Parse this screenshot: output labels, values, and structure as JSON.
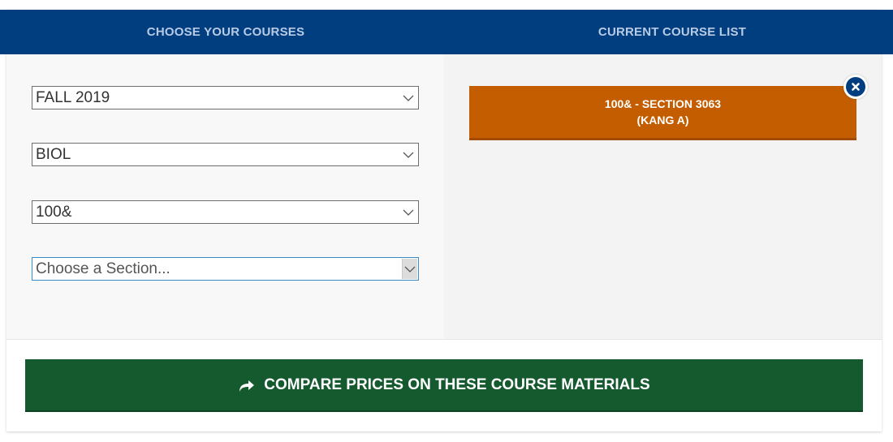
{
  "header": {
    "left_tab": "CHOOSE YOUR COURSES",
    "right_tab": "CURRENT COURSE LIST"
  },
  "selectors": {
    "term": "FALL 2019",
    "department": "BIOL",
    "course": "100&",
    "section": "Choose a Section..."
  },
  "course_list": {
    "items": [
      {
        "line1": "100& - SECTION 3063",
        "line2": "(KANG A)"
      }
    ]
  },
  "actions": {
    "compare_label": "COMPARE PRICES ON THESE COURSE MATERIALS"
  },
  "icons": {
    "chevron": "chevron-down-icon",
    "remove": "close-icon",
    "compare": "share-arrow-icon"
  },
  "colors": {
    "header_bg": "#003e80",
    "course_card": "#c45d00",
    "compare_button": "#155a2f"
  }
}
